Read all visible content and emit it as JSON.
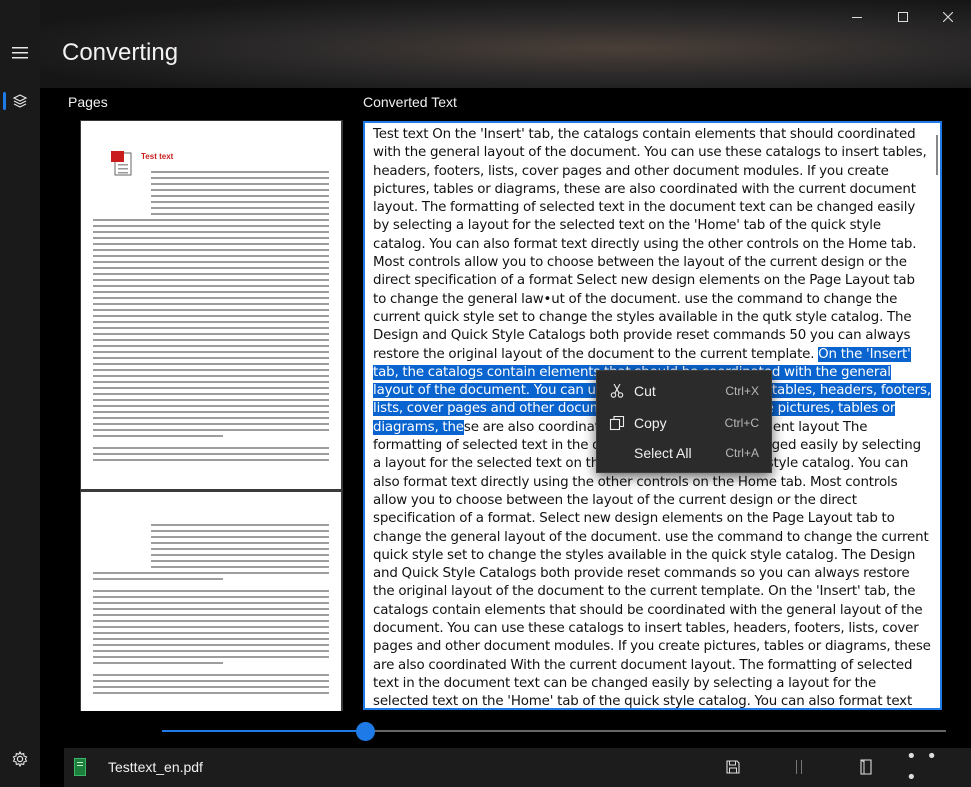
{
  "window": {
    "minimize_glyph": "—",
    "maximize_glyph": "☐",
    "close_glyph": "✕"
  },
  "header": {
    "title": "Converting"
  },
  "nav": {
    "menu_icon": "hamburger-icon",
    "pages_icon": "layers-icon",
    "settings_icon": "gear-icon"
  },
  "pages_panel": {
    "label": "Pages",
    "thumbnails": [
      {
        "title": "Test text"
      },
      {
        "title": ""
      }
    ]
  },
  "text_panel": {
    "label": "Converted Text",
    "text_before": "Test text On the 'Insert' tab, the catalogs contain elements that should coordinated with the general layout of the document. You can use these catalogs to insert tables, headers, footers, lists, cover pages and other document modules. If you create pictures, tables or diagrams, these are also coordinated with the current document layout. The formatting of selected text in the document text can be changed easily by selecting a layout for the selected text on the 'Home' tab of the quick style catalog. You can also format text directly using the other controls on the Home tab. Most controls allow you to choose between the layout of the current design or the direct specification of a format Select new design elements on the Page Layout tab to change the general law•ut of the document. use the command to change the current quick style set to change the styles available in the qutk style catalog. The Design and Quick Style Catalogs both provide reset commands 50 you can always restore the original layout of the document to the current template. ",
    "text_selected": "On the 'Insert' tab, the catalogs contain elements that should be coordinated with the general layout of the document. You can use these catalogs to insert tables, headers, footers, lists, cover pages and other document modules. If you create pictures, tables or diagrams, the",
    "text_after": "se are also coordinated with the current document layout The formatting of selected text in the document text can be changed easily by selecting a layout for the selected text on the 'Home' tab of the quick style catalog. You can also format text directly using the other controls on the Home tab. Most controls allow you to choose between the layout of the current design or the direct specification of a format. Select new design elements on the Page Layout tab to change the general layout of the document. use the command to change the current quick style set to change the styles available in the quick style catalog. The Design and Quick Style Catalogs both provide reset commands so you can always restore the original layout of the document to the current template. On the 'Insert' tab, the catalogs contain elements that should be coordinated with the general layout of the document. You can use these catalogs to insert tables, headers, footers, lists, cover pages and other document modules. If you create pictures, tables or diagrams, these are also coordinated With the current document layout. The formatting of selected text in the document text can be changed easily by selecting a layout for the selected text on the 'Home' tab of the quick style catalog. You can also format text directly using the other controls on the Home tab. Most controls allow you to choose between the layout of the current design or the direct specification of a format. Select new design elements on the Page Layout tab to change the general layout of the document. use"
  },
  "context_menu": {
    "items": [
      {
        "label": "Cut",
        "shortcut": "Ctrl+X",
        "icon": "scissors-icon"
      },
      {
        "label": "Copy",
        "shortcut": "Ctrl+C",
        "icon": "copy-icon"
      },
      {
        "label": "Select All",
        "shortcut": "Ctrl+A",
        "icon": ""
      }
    ]
  },
  "slider": {
    "value_fraction": 0.26
  },
  "bottom_bar": {
    "file_name": "Testtext_en.pdf",
    "file_icon": "document-icon",
    "save_icon": "save-icon",
    "split_icon": "split-view-icon",
    "book_icon": "book-icon",
    "more_label": "• • •"
  },
  "colors": {
    "accent": "#1e7ae6",
    "selection": "#0a64cf",
    "pdf_title_red": "#c91d1d"
  }
}
